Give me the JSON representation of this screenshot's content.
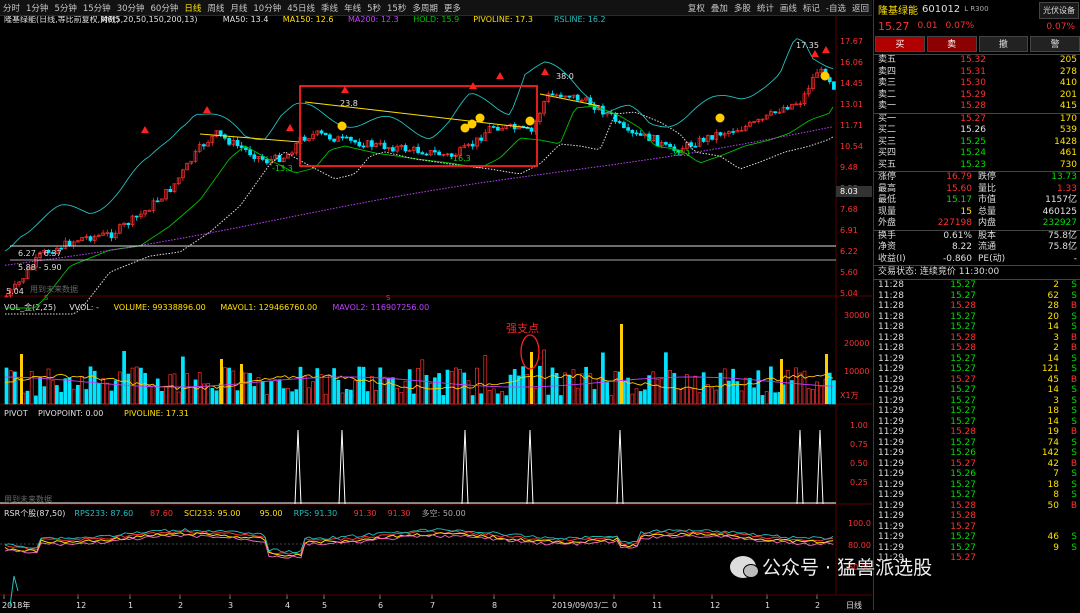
{
  "periods": [
    {
      "label": "分时",
      "active": false
    },
    {
      "label": "1分钟",
      "active": false
    },
    {
      "label": "5分钟",
      "active": false
    },
    {
      "label": "15分钟",
      "active": false
    },
    {
      "label": "30分钟",
      "active": false
    },
    {
      "label": "60分钟",
      "active": false
    },
    {
      "label": "日线",
      "active": true
    },
    {
      "label": "周线",
      "active": false
    },
    {
      "label": "月线",
      "active": false
    },
    {
      "label": "10分钟",
      "active": false
    },
    {
      "label": "45日线",
      "active": false
    },
    {
      "label": "季线",
      "active": false
    },
    {
      "label": "年线",
      "active": false
    },
    {
      "label": "5秒",
      "active": false
    },
    {
      "label": "15秒",
      "active": false
    },
    {
      "label": "多周期",
      "active": false
    },
    {
      "label": "更多",
      "active": false
    }
  ],
  "right_tools": [
    "复权",
    "叠加",
    "多股",
    "统计",
    "画线",
    "标记",
    "-自选",
    "返回"
  ],
  "main_header": {
    "title": "隆基绿能(日线,等比前复权,对数)",
    "m6": "M6(5,20,50,150,200,13)",
    "ma50": "MA50: 13.4",
    "ma150": "MA150: 12.6",
    "ma200": "MA200: 12.3",
    "hold": "HOLD: 15.9",
    "pivoline": "PIVOLINE: 17.3",
    "rsline": "RSLINE: 16.2"
  },
  "price_axis": [
    "17.67",
    "16.06",
    "14.45",
    "13.01",
    "11.71",
    "10.54",
    "9.48",
    "8.53",
    "7.68",
    "6.91",
    "6.22",
    "5.60",
    "5.04"
  ],
  "price_box": "8.03",
  "chart_annotations": {
    "high": "17.35",
    "a238": "23.8",
    "a380": "38.0",
    "n133": "-13.3",
    "n163": "-16.3",
    "n261": "-26.1",
    "r1": "6.27 - 6.37",
    "r2": "5.88 - 5.90",
    "low": "5.04",
    "overlay1": "用到未来数据",
    "s1": "S",
    "s2": "S"
  },
  "vol_header": {
    "title": "VOL_金(2,25)",
    "vvol": "VVOL: -",
    "volume": "VOLUME: 99338896.00",
    "mavol1": "MAVOL1: 129466760.00",
    "mavol2": "MAVOL2: 116907256.00"
  },
  "vol_axis": [
    "30000",
    "20000",
    "10000"
  ],
  "vol_unit": "X1万",
  "vol_annotation": "强支点",
  "pivot_header": {
    "title": "PIVOT",
    "pivotpoint": "PIVOPOINT: 0.00",
    "pivoline": "PIVOLINE: 17.31"
  },
  "pivot_axis": [
    "1.00",
    "0.75",
    "0.50",
    "0.25"
  ],
  "pivot_overlay": "用到未来数据",
  "rsr_header": {
    "title": "RSR个股(87,50)",
    "rps233": "RPS233: 87.60",
    "v1": "87.60",
    "sci233": "SCI233: 95.00",
    "v2": "95.00",
    "rps": "RPS: 91.30",
    "v3": "91.30",
    "v4": "91.30",
    "duokong": "多空: 50.00"
  },
  "rsr_axis": [
    "100.0",
    "80.00",
    "60.00"
  ],
  "x_axis": [
    "2018年",
    "12",
    "1",
    "2",
    "3",
    "4",
    "5",
    "6",
    "7",
    "8",
    "2019/09/03/二",
    "0",
    "11",
    "12",
    "1",
    "2"
  ],
  "x_axis_right": "日线",
  "stock": {
    "name": "隆基绿能",
    "code": "601012",
    "lr": "L R300",
    "brand": "光伏设备",
    "price": "15.27",
    "change": "0.01",
    "pct": "0.07%",
    "pct2": "0.07%"
  },
  "buttons": [
    "买",
    "卖",
    "撤",
    "警"
  ],
  "asks": [
    {
      "label": "卖五",
      "price": "15.32",
      "vol": "205"
    },
    {
      "label": "卖四",
      "price": "15.31",
      "vol": "278"
    },
    {
      "label": "卖三",
      "price": "15.30",
      "vol": "410"
    },
    {
      "label": "卖二",
      "price": "15.29",
      "vol": "201"
    },
    {
      "label": "卖一",
      "price": "15.28",
      "vol": "415"
    }
  ],
  "bids": [
    {
      "label": "买一",
      "price": "15.27",
      "vol": "170",
      "color": "red"
    },
    {
      "label": "买二",
      "price": "15.26",
      "vol": "539",
      "color": "white"
    },
    {
      "label": "买三",
      "price": "15.25",
      "vol": "1428",
      "color": "green"
    },
    {
      "label": "买四",
      "price": "15.24",
      "vol": "461",
      "color": "green"
    },
    {
      "label": "买五",
      "price": "15.23",
      "vol": "730",
      "color": "green"
    }
  ],
  "stats1": [
    {
      "l": "涨停",
      "v": "16.79",
      "vc": "red",
      "l2": "跌停",
      "v2": "13.73",
      "v2c": "green"
    },
    {
      "l": "最高",
      "v": "15.60",
      "vc": "red",
      "l2": "量比",
      "v2": "1.33",
      "v2c": "red"
    },
    {
      "l": "最低",
      "v": "15.17",
      "vc": "green",
      "l2": "市值",
      "v2": "1157亿",
      "v2c": "white"
    },
    {
      "l": "现量",
      "v": "15",
      "vc": "yellow",
      "l2": "总量",
      "v2": "460125",
      "v2c": "white"
    },
    {
      "l": "外盘",
      "v": "227198",
      "vc": "red",
      "l2": "内盘",
      "v2": "232927",
      "v2c": "green"
    }
  ],
  "stats2": [
    {
      "l": "换手",
      "v": "0.61%",
      "vc": "white",
      "l2": "股本",
      "v2": "75.8亿",
      "v2c": "white"
    },
    {
      "l": "净资",
      "v": "8.22",
      "vc": "white",
      "l2": "流通",
      "v2": "75.8亿",
      "v2c": "white"
    },
    {
      "l": "收益(I)",
      "v": "-0.860",
      "vc": "white",
      "l2": "PE(动)",
      "v2": "-",
      "v2c": "white"
    }
  ],
  "status": "交易状态: 连续竞价 11:30:00",
  "trades": [
    [
      "11:28",
      "15.27",
      "2",
      "S",
      "green"
    ],
    [
      "11:28",
      "15.27",
      "62",
      "S",
      "green"
    ],
    [
      "11:28",
      "15.28",
      "28",
      "B",
      "red"
    ],
    [
      "11:28",
      "15.27",
      "20",
      "S",
      "green"
    ],
    [
      "11:28",
      "15.27",
      "14",
      "S",
      "green"
    ],
    [
      "11:28",
      "15.28",
      "3",
      "B",
      "red"
    ],
    [
      "11:28",
      "15.28",
      "2",
      "B",
      "red"
    ],
    [
      "11:29",
      "15.27",
      "14",
      "S",
      "green"
    ],
    [
      "11:29",
      "15.27",
      "121",
      "S",
      "green"
    ],
    [
      "11:29",
      "15.27",
      "45",
      "B",
      "red"
    ],
    [
      "11:29",
      "15.27",
      "14",
      "S",
      "green"
    ],
    [
      "11:29",
      "15.27",
      "3",
      "S",
      "green"
    ],
    [
      "11:29",
      "15.27",
      "18",
      "S",
      "green"
    ],
    [
      "11:29",
      "15.27",
      "14",
      "S",
      "green"
    ],
    [
      "11:29",
      "15.28",
      "19",
      "B",
      "red"
    ],
    [
      "11:29",
      "15.27",
      "74",
      "S",
      "green"
    ],
    [
      "11:29",
      "15.26",
      "142",
      "S",
      "green"
    ],
    [
      "11:29",
      "15.27",
      "42",
      "B",
      "red"
    ],
    [
      "11:29",
      "15.26",
      "7",
      "S",
      "green"
    ],
    [
      "11:29",
      "15.27",
      "18",
      "S",
      "green"
    ],
    [
      "11:29",
      "15.27",
      "8",
      "S",
      "green"
    ],
    [
      "11:29",
      "15.28",
      "50",
      "B",
      "red"
    ],
    [
      "11:29",
      "15.28",
      "",
      "",
      "red"
    ],
    [
      "11:29",
      "15.27",
      "",
      "",
      "red"
    ],
    [
      "11:29",
      "15.27",
      "46",
      "S",
      "green"
    ],
    [
      "11:29",
      "15.27",
      "9",
      "S",
      "green"
    ],
    [
      "11:29",
      "15.27",
      "",
      "",
      "red"
    ]
  ],
  "watermark": "公众号 · 猛兽派选股",
  "colors": {
    "up": "#ff3030",
    "down": "#00e5ff",
    "ma_yellow": "#ffe000",
    "ma_green": "#00c000",
    "ma_purple": "#c040ff",
    "ma_white": "#e0e0e0",
    "ma_cyan": "#20c0c0",
    "box": "#ff2020"
  }
}
